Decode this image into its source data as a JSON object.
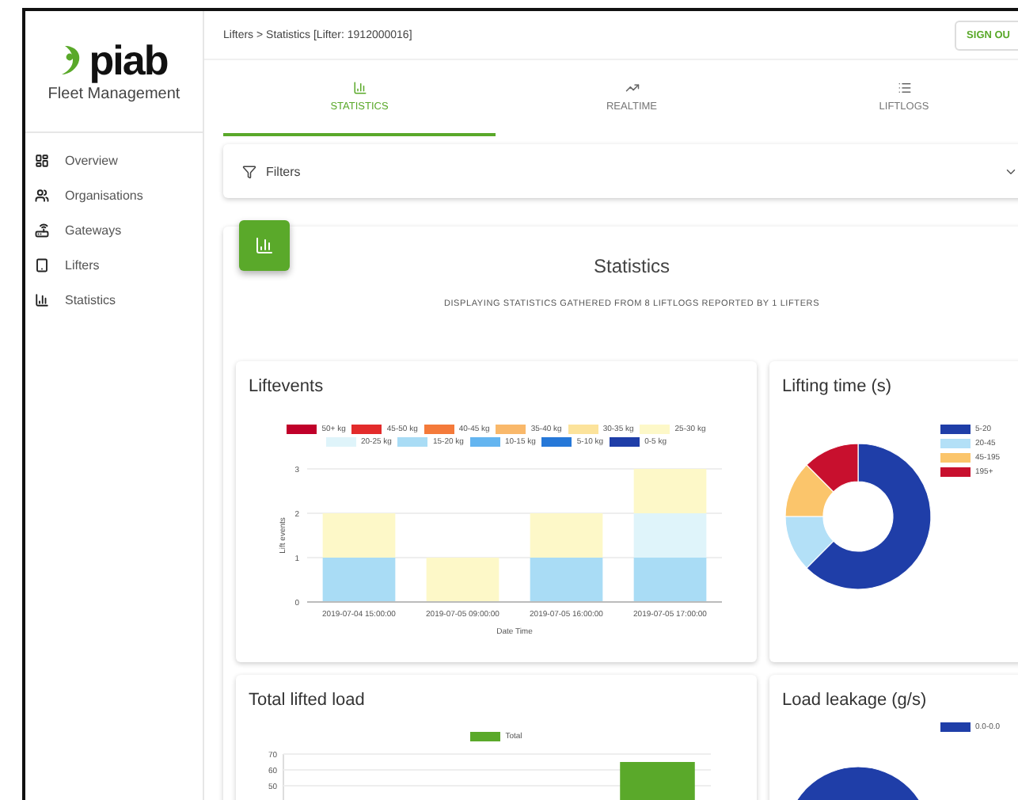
{
  "logo": {
    "brand": "piab",
    "subtitle": "Fleet Management"
  },
  "sidebar": {
    "items": [
      {
        "label": "Overview",
        "kind": "overview",
        "selected": false
      },
      {
        "label": "Organisations",
        "kind": "organisations",
        "selected": false
      },
      {
        "label": "Gateways",
        "kind": "gateways",
        "selected": false
      },
      {
        "label": "Lifters",
        "kind": "lifters",
        "selected": false
      },
      {
        "label": "Statistics",
        "kind": "statistics",
        "selected": false
      }
    ]
  },
  "header": {
    "breadcrumb": "Lifters > Statistics [Lifter: 1912000016]",
    "sign_out": "SIGN OU"
  },
  "tabs": [
    {
      "label": "STATISTICS",
      "kind": "statistics",
      "selected": true
    },
    {
      "label": "REALTIME",
      "kind": "realtime",
      "selected": false
    },
    {
      "label": "LIFTLOGS",
      "kind": "liftlogs",
      "selected": false
    }
  ],
  "filters": {
    "label": "Filters",
    "expanded": false
  },
  "statistics": {
    "title": "Statistics",
    "subtitle": "DISPLAYING STATISTICS GATHERED FROM 8 LIFTLOGS REPORTED BY 1 LIFTERS",
    "cards": [
      {
        "title": "Liftevents",
        "chart_data": {
          "type": "bar",
          "stacked": true,
          "legend": "top",
          "xlabel": "Date Time",
          "ylabel": "Lift events",
          "categories": [
            "2019-07-04 15:00:00",
            "2019-07-05 09:00:00",
            "2019-07-05 16:00:00",
            "2019-07-05 17:00:00"
          ],
          "ylim": [
            0,
            3
          ],
          "yticks": [
            0,
            1,
            2,
            3
          ],
          "series": [
            {
              "name": "50+ kg",
              "color": "#c0002a",
              "values": [
                0,
                0,
                0,
                0
              ]
            },
            {
              "name": "45-50 kg",
              "color": "#e32b2b",
              "values": [
                0,
                0,
                0,
                0
              ]
            },
            {
              "name": "40-45 kg",
              "color": "#f47a3a",
              "values": [
                0,
                0,
                0,
                0
              ]
            },
            {
              "name": "35-40 kg",
              "color": "#f9b86a",
              "values": [
                0,
                0,
                0,
                0
              ]
            },
            {
              "name": "30-35 kg",
              "color": "#fce39b",
              "values": [
                0,
                0,
                0,
                0
              ]
            },
            {
              "name": "25-30 kg",
              "color": "#fdf8c8",
              "values": [
                1,
                1,
                1,
                1
              ]
            },
            {
              "name": "20-25 kg",
              "color": "#dff4fa",
              "values": [
                0,
                0,
                0,
                1
              ]
            },
            {
              "name": "15-20 kg",
              "color": "#a9dcf5",
              "values": [
                1,
                0,
                1,
                1
              ]
            },
            {
              "name": "10-15 kg",
              "color": "#64b5f0",
              "values": [
                0,
                0,
                0,
                0
              ]
            },
            {
              "name": "5-10 kg",
              "color": "#2678d8",
              "values": [
                0,
                0,
                0,
                0
              ]
            },
            {
              "name": "0-5 kg",
              "color": "#1f3ea8",
              "values": [
                0,
                0,
                0,
                0
              ]
            }
          ]
        }
      },
      {
        "title": "Lifting time (s)",
        "chart_data": {
          "type": "donut",
          "legend": "right",
          "categories": [
            "5-20",
            "20-45",
            "45-195",
            "195+"
          ],
          "values": [
            5,
            1,
            1,
            1
          ],
          "colors": [
            "#1f3ea8",
            "#b3e0f7",
            "#fbc56b",
            "#c8102e"
          ]
        }
      },
      {
        "title": "Total lifted load",
        "chart_data": {
          "type": "bar",
          "legend": "top",
          "ylim": [
            0,
            70
          ],
          "yticks": [
            50,
            60,
            70
          ],
          "series": [
            {
              "name": "Total",
              "color": "#5aa92a",
              "values": [
                null,
                null,
                null,
                65
              ]
            }
          ]
        }
      },
      {
        "title": "Load leakage (g/s)",
        "chart_data": {
          "type": "pie",
          "legend": "right",
          "categories": [
            "0.0-0.0"
          ],
          "values": [
            1
          ],
          "colors": [
            "#1f3ea8"
          ]
        }
      }
    ]
  }
}
